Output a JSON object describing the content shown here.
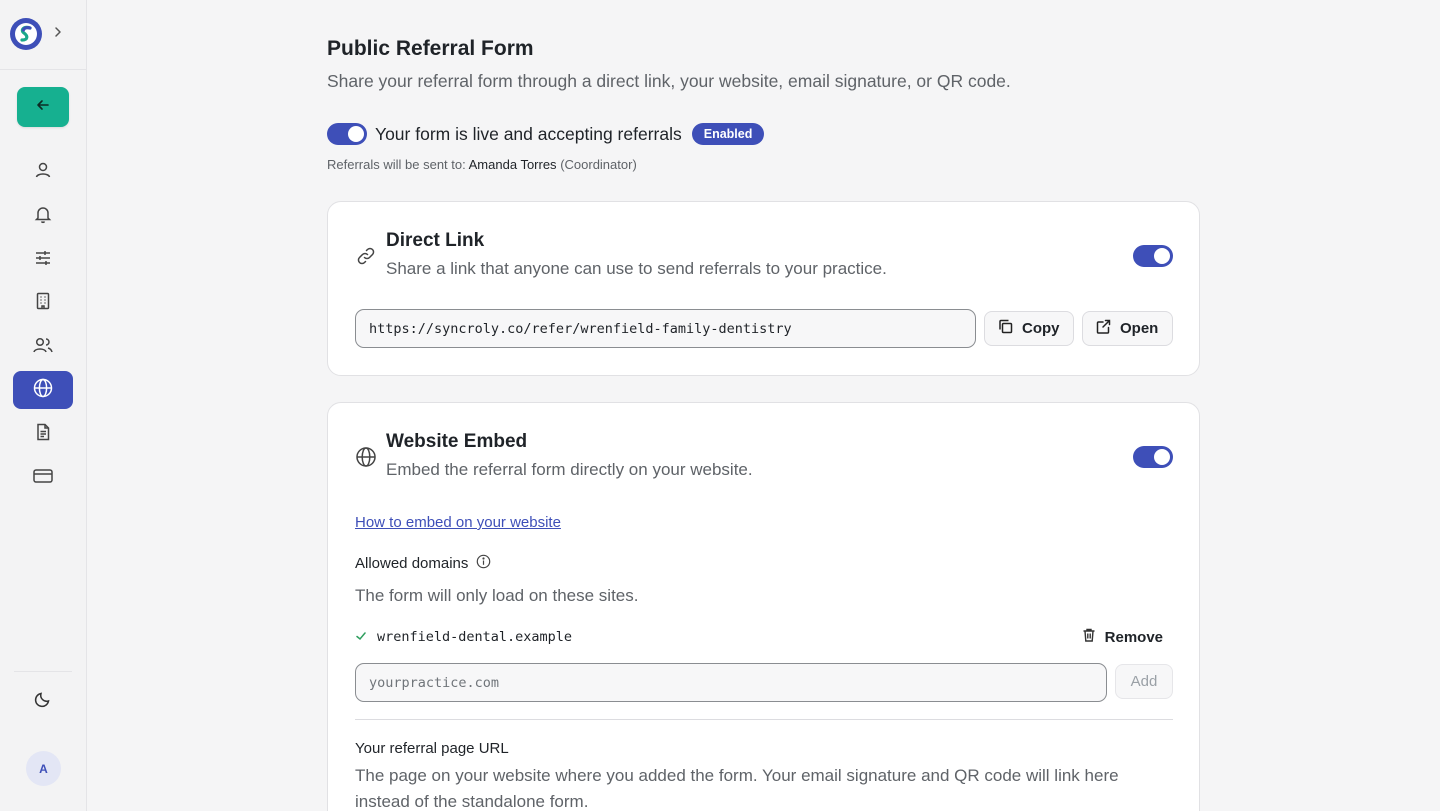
{
  "sidebar": {
    "nav_items": [
      {
        "icon": "user-icon",
        "active": false
      },
      {
        "icon": "bell-icon",
        "active": false
      },
      {
        "icon": "sliders-icon",
        "active": false
      },
      {
        "icon": "building-icon",
        "active": false
      },
      {
        "icon": "users-icon",
        "active": false
      },
      {
        "icon": "globe-icon",
        "active": true
      },
      {
        "icon": "document-icon",
        "active": false
      },
      {
        "icon": "credit-card-icon",
        "active": false
      }
    ],
    "theme_icon": "moon-icon",
    "avatar_initial": "A"
  },
  "page": {
    "title": "Public Referral Form",
    "subtitle": "Share your referral form through a direct link, your website, email signature, or QR code.",
    "live_label": "Your form is live and accepting referrals",
    "status_badge": "Enabled",
    "recipient_prefix": "Referrals will be sent to:",
    "recipient_name": "Amanda Torres",
    "recipient_role": "(Coordinator)"
  },
  "direct_link": {
    "title": "Direct Link",
    "description": "Share a link that anyone can use to send referrals to your practice.",
    "url": "https://syncroly.co/refer/wrenfield-family-dentistry",
    "copy_label": "Copy",
    "open_label": "Open",
    "enabled": true
  },
  "website_embed": {
    "title": "Website Embed",
    "description": "Embed the referral form directly on your website.",
    "enabled": true,
    "how_to_link": "How to embed on your website",
    "allowed_domains_label": "Allowed domains",
    "allowed_domains_help": "The form will only load on these sites.",
    "domains": [
      "wrenfield-dental.example"
    ],
    "remove_label": "Remove",
    "domain_placeholder": "yourpractice.com",
    "add_label": "Add",
    "referral_url_label": "Your referral page URL",
    "referral_url_help": "The page on your website where you added the form. Your email signature and QR code will link here instead of the standalone form."
  },
  "colors": {
    "accent": "#3e4fb8",
    "back_button": "#16b090"
  }
}
